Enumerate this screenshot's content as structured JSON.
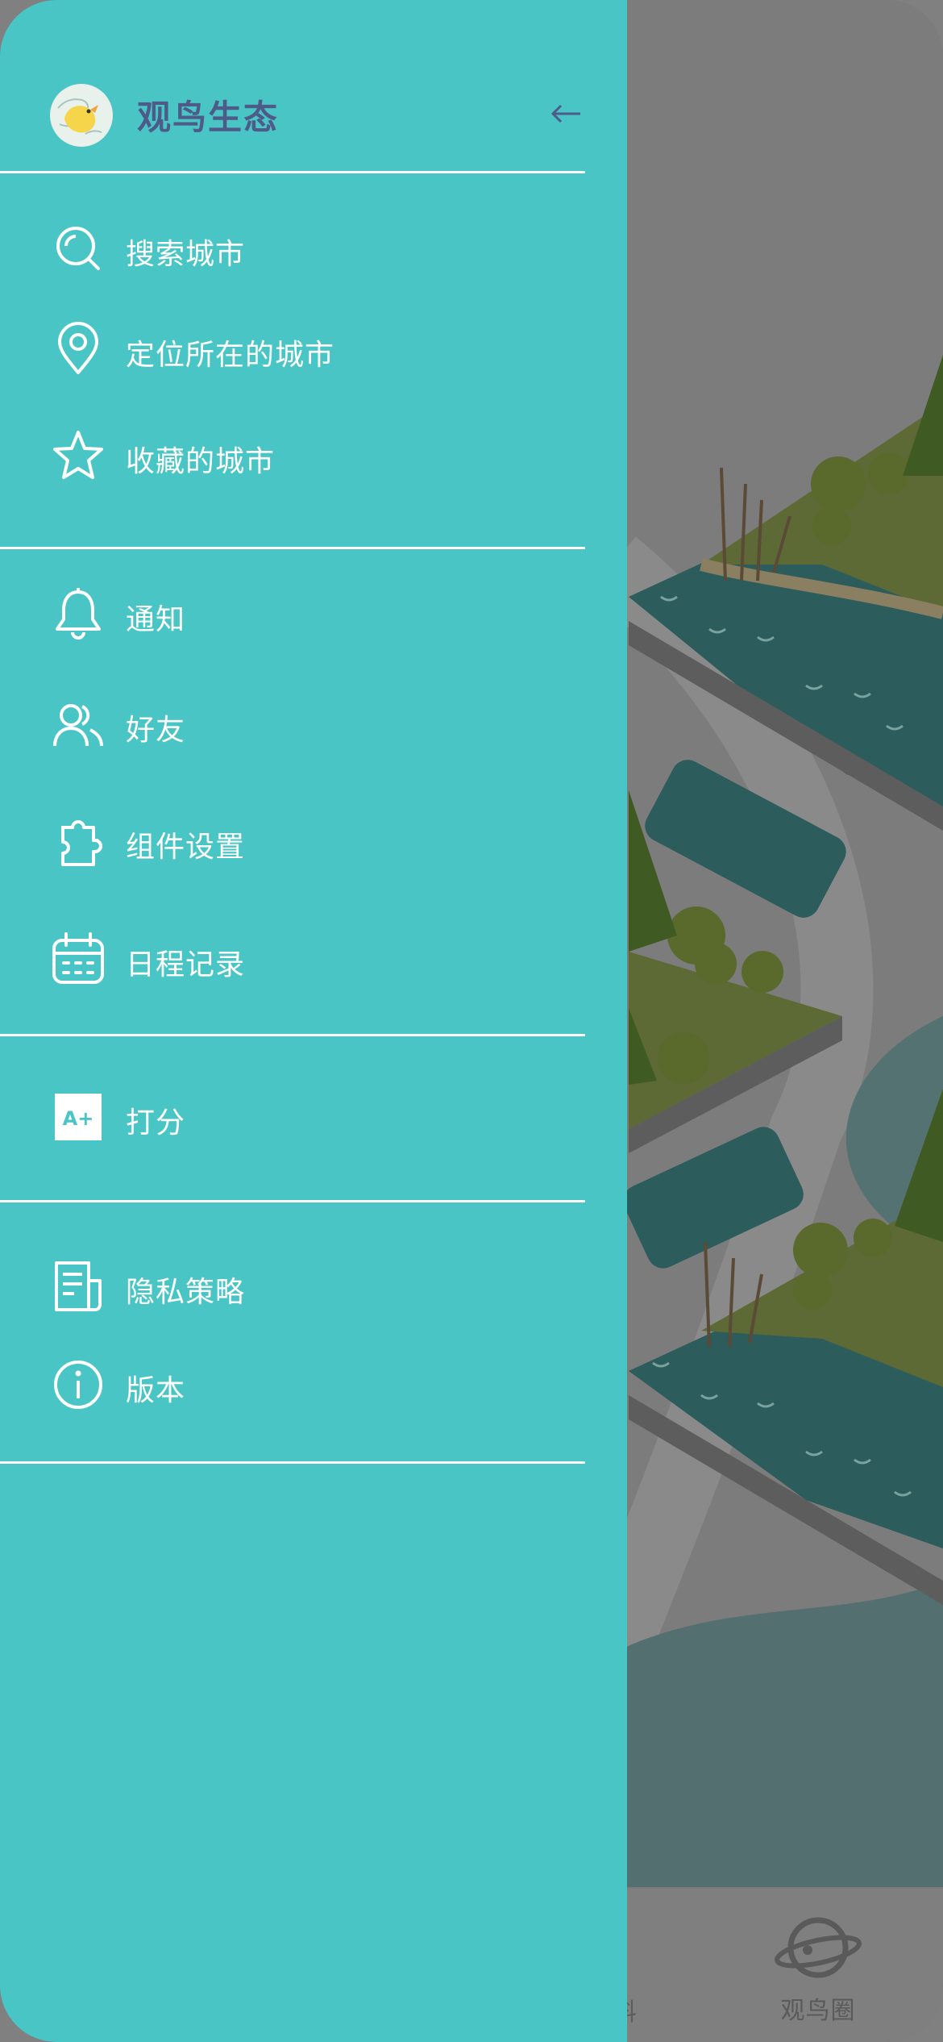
{
  "drawer": {
    "app_title": "观鸟生态",
    "groups": [
      {
        "items": [
          {
            "label": "搜索城市",
            "icon": "search-icon"
          },
          {
            "label": "定位所在的城市",
            "icon": "location-pin-icon"
          },
          {
            "label": "收藏的城市",
            "icon": "star-icon"
          }
        ]
      },
      {
        "items": [
          {
            "label": "通知",
            "icon": "bell-icon"
          },
          {
            "label": "好友",
            "icon": "friends-icon"
          },
          {
            "label": "组件设置",
            "icon": "puzzle-icon"
          },
          {
            "label": "日程记录",
            "icon": "calendar-icon"
          }
        ]
      },
      {
        "items": [
          {
            "label": "打分",
            "icon": "rating-badge-icon",
            "badge_text": "A+"
          }
        ]
      },
      {
        "items": [
          {
            "label": "隐私策略",
            "icon": "document-icon"
          },
          {
            "label": "版本",
            "icon": "info-icon"
          }
        ]
      }
    ]
  },
  "tabbar": {
    "partial_label": "料",
    "active_tab_label": "观鸟圈",
    "active_tab_icon": "planet-icon"
  },
  "colors": {
    "drawer_bg": "#4ac5c5",
    "title": "#4e5b88",
    "text": "#ffffff",
    "overlay": "#7a7a7a"
  }
}
